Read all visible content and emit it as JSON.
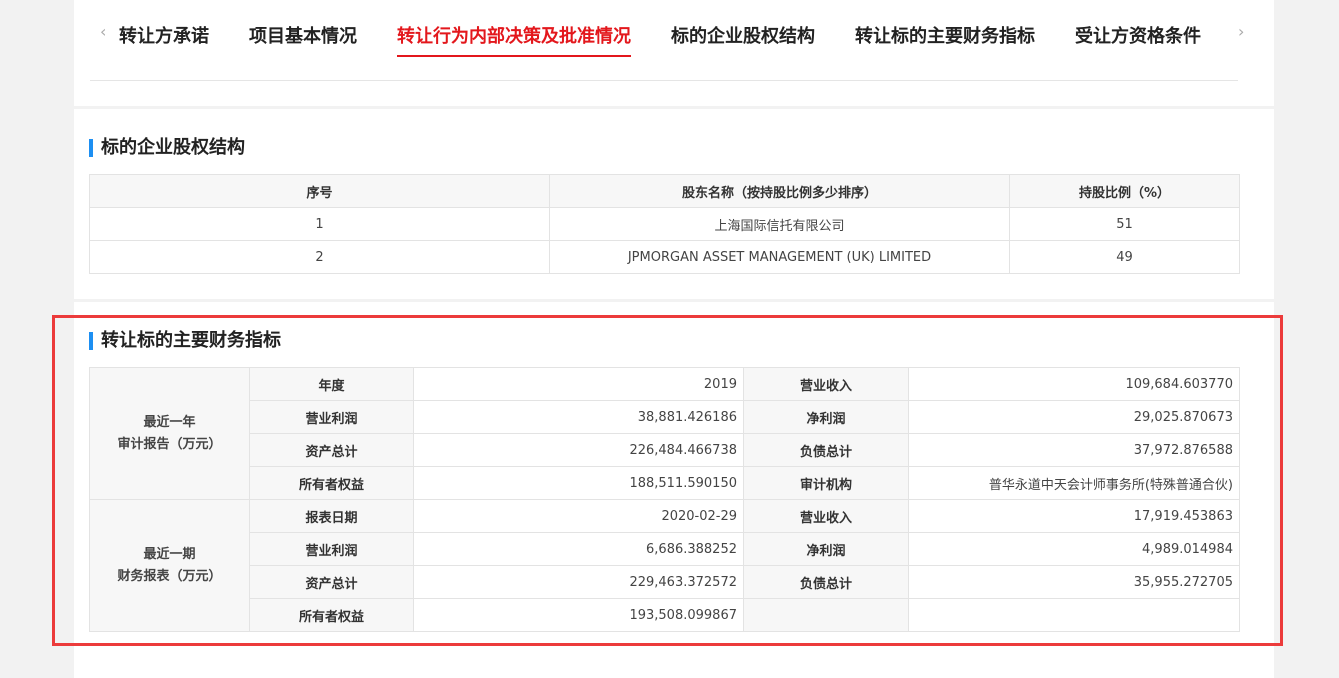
{
  "nav": {
    "prev_icon": "chevron-left-icon",
    "next_icon": "chevron-right-icon",
    "prev_glyph": "‹",
    "next_glyph": "›",
    "tabs": [
      {
        "label": "转让方承诺"
      },
      {
        "label": "项目基本情况"
      },
      {
        "label": "转让行为内部决策及批准情况"
      },
      {
        "label": "标的企业股权结构"
      },
      {
        "label": "转让标的主要财务指标"
      },
      {
        "label": "受让方资格条件"
      }
    ],
    "active_tab_index": 2,
    "active_color": "#e3171c"
  },
  "equity": {
    "title": "标的企业股权结构",
    "headers": [
      "序号",
      "股东名称（按持股比例多少排序）",
      "持股比例（%）"
    ],
    "rows": [
      [
        "1",
        "上海国际信托有限公司",
        "51"
      ],
      [
        "2",
        "JPMORGAN ASSET MANAGEMENT (UK) LIMITED",
        "49"
      ]
    ]
  },
  "financials": {
    "title": "转让标的主要财务指标",
    "groups": [
      {
        "label_line1": "最近一年",
        "label_line2": "审计报告（万元）",
        "rows": [
          [
            "年度",
            "2019",
            "营业收入",
            "109,684.603770"
          ],
          [
            "营业利润",
            "38,881.426186",
            "净利润",
            "29,025.870673"
          ],
          [
            "资产总计",
            "226,484.466738",
            "负债总计",
            "37,972.876588"
          ],
          [
            "所有者权益",
            "188,511.590150",
            "审计机构",
            "普华永道中天会计师事务所(特殊普通合伙)"
          ]
        ]
      },
      {
        "label_line1": "最近一期",
        "label_line2": "财务报表（万元）",
        "rows": [
          [
            "报表日期",
            "2020-02-29",
            "营业收入",
            "17,919.453863"
          ],
          [
            "营业利润",
            "6,686.388252",
            "净利润",
            "4,989.014984"
          ],
          [
            "资产总计",
            "229,463.372572",
            "负债总计",
            "35,955.272705"
          ],
          [
            "所有者权益",
            "193,508.099867",
            "",
            ""
          ]
        ]
      }
    ]
  },
  "colors": {
    "accent_bar": "#1d8ff2",
    "highlight_box": "#ec3b3b"
  }
}
